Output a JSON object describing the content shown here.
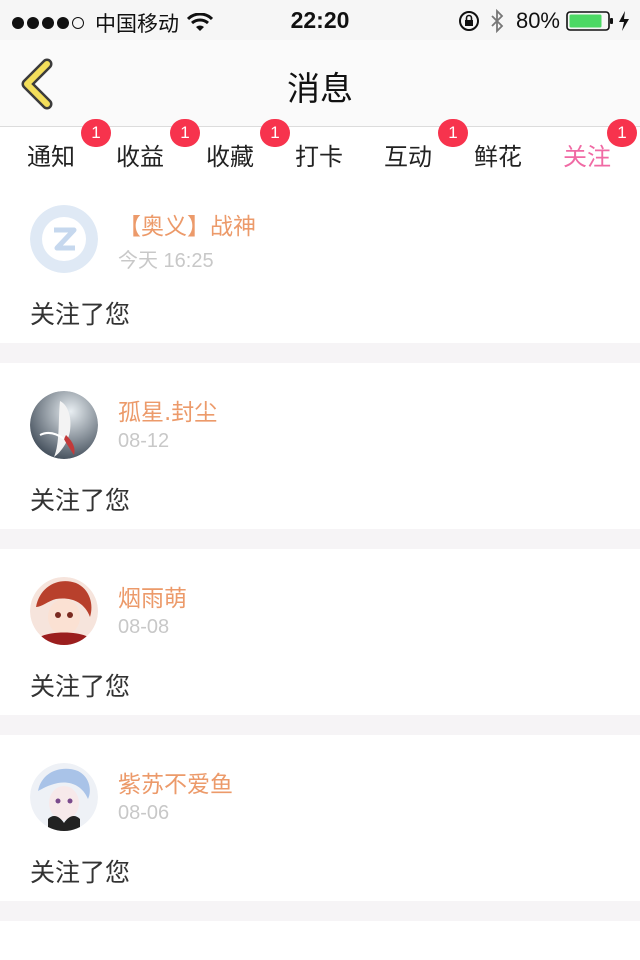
{
  "status_bar": {
    "carrier": "中国移动",
    "time": "22:20",
    "battery": "80%"
  },
  "nav": {
    "title": "消息"
  },
  "tabs": [
    {
      "label": "通知",
      "badge": "1"
    },
    {
      "label": "收益",
      "badge": "1"
    },
    {
      "label": "收藏",
      "badge": "1"
    },
    {
      "label": "打卡",
      "badge": ""
    },
    {
      "label": "互动",
      "badge": "1"
    },
    {
      "label": "鲜花",
      "badge": ""
    },
    {
      "label": "关注",
      "badge": "1"
    }
  ],
  "active_tab": "关注",
  "messages": [
    {
      "username": "【奥义】战神",
      "time": "今天 16:25",
      "text": "关注了您",
      "avatar": "default-q-avatar"
    },
    {
      "username": "孤星.封尘",
      "time": "08-12",
      "text": "关注了您",
      "avatar": "user-avatar"
    },
    {
      "username": "烟雨萌",
      "time": "08-08",
      "text": "关注了您",
      "avatar": "user-avatar"
    },
    {
      "username": "紫苏不爱鱼",
      "time": "08-06",
      "text": "关注了您",
      "avatar": "user-avatar"
    }
  ],
  "colors": {
    "accent": "#f06aa4",
    "badge": "#f7334d",
    "username": "#ec9a6a",
    "back_arrow": "#f3de5b"
  }
}
